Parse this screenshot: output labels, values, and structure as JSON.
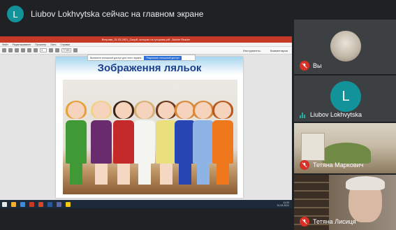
{
  "banner": {
    "avatar_letter": "L",
    "text": "Liubov Lokhvytska сейчас на главном экране"
  },
  "shared_screen": {
    "window_title": "Ветрова_31.03.2021_Скорб, историс та гуторова.pdf - Adobe Reader",
    "menu": [
      "Файл",
      "Редактирование",
      "Просмотр",
      "Окно",
      "Справка"
    ],
    "page_value": "4",
    "zoom_value": "77,5%",
    "toolbar_right": [
      "Инструменты",
      "Комментарии"
    ],
    "notice_text": "Включите сплошной доступ для этого экрана",
    "notice_button": "Разрешить сплошной доступ",
    "slide_title": "Зображення ляльок",
    "clock_time": "11:03",
    "clock_date": "31.03.2021"
  },
  "participants": [
    {
      "name": "Вы",
      "muted": true
    },
    {
      "name": "Liubov Lokhvytska",
      "avatar_letter": "L",
      "speaking": true
    },
    {
      "name": "Тетяна Маркович",
      "muted": true
    },
    {
      "name": "Тетяна Лисиця",
      "muted": true
    }
  ],
  "colors": {
    "accent_teal": "#12939a",
    "mute_red": "#d93025",
    "background": "#202124",
    "slide_title": "#1b3f8f"
  }
}
